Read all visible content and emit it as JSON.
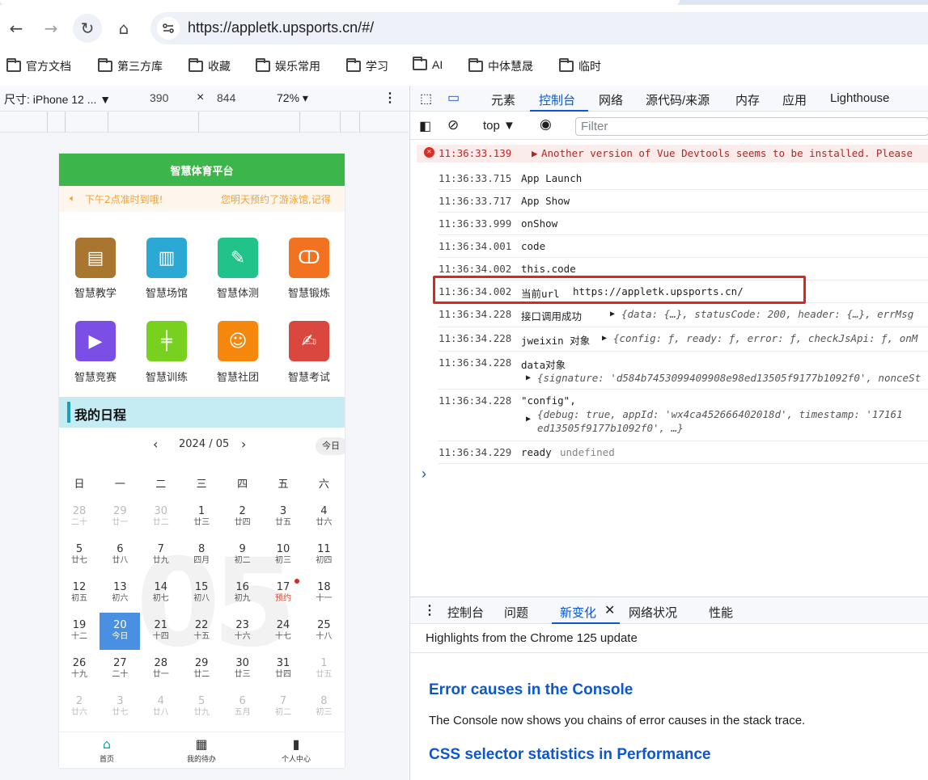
{
  "browser": {
    "url": "https://appletk.upsports.cn/#/",
    "bookmarks": [
      "官方文档",
      "第三方库",
      "收藏",
      "娱乐常用",
      "学习",
      "AI",
      "中体慧晟",
      "临时"
    ]
  },
  "device_toolbar": {
    "device": "尺寸: iPhone 12 ...",
    "width": "390",
    "times": "×",
    "height": "844",
    "zoom": "72%"
  },
  "app": {
    "header_title": "智慧体育平台",
    "notice_left": "下午2点准时到哦!",
    "notice_right": "您明天预约了游泳馆,记得",
    "grid": [
      {
        "label": "智慧教学",
        "color": "#a8762e",
        "icon": "printer-icon"
      },
      {
        "label": "智慧场馆",
        "color": "#2ba9d4",
        "icon": "building-icon"
      },
      {
        "label": "智慧体测",
        "color": "#22c38a",
        "icon": "clipboard-icon"
      },
      {
        "label": "智慧锻炼",
        "color": "#f3721f",
        "icon": "exercise-icon"
      },
      {
        "label": "智慧竞赛",
        "color": "#7b4fe6",
        "icon": "flag-icon"
      },
      {
        "label": "智慧训练",
        "color": "#78d11f",
        "icon": "dumbbell-icon"
      },
      {
        "label": "智慧社团",
        "color": "#f5870d",
        "icon": "group-icon"
      },
      {
        "label": "智慧考试",
        "color": "#d9473e",
        "icon": "exam-icon"
      }
    ],
    "schedule_title": "我的日程",
    "calendar": {
      "month_label": "2024 / 05",
      "today_button": "今日",
      "watermark": "05",
      "weekdays": [
        "日",
        "一",
        "二",
        "三",
        "四",
        "五",
        "六"
      ],
      "weeks": [
        [
          {
            "n": "28",
            "l": "二十",
            "o": true
          },
          {
            "n": "29",
            "l": "廿一",
            "o": true
          },
          {
            "n": "30",
            "l": "廿二",
            "o": true
          },
          {
            "n": "1",
            "l": "廿三"
          },
          {
            "n": "2",
            "l": "廿四"
          },
          {
            "n": "3",
            "l": "廿五"
          },
          {
            "n": "4",
            "l": "廿六"
          }
        ],
        [
          {
            "n": "5",
            "l": "廿七"
          },
          {
            "n": "6",
            "l": "廿八"
          },
          {
            "n": "7",
            "l": "廿九"
          },
          {
            "n": "8",
            "l": "四月"
          },
          {
            "n": "9",
            "l": "初二"
          },
          {
            "n": "10",
            "l": "初三"
          },
          {
            "n": "11",
            "l": "初四"
          }
        ],
        [
          {
            "n": "12",
            "l": "初五"
          },
          {
            "n": "13",
            "l": "初六"
          },
          {
            "n": "14",
            "l": "初七"
          },
          {
            "n": "15",
            "l": "初八"
          },
          {
            "n": "16",
            "l": "初九"
          },
          {
            "n": "17",
            "l": "预约",
            "mark": true
          },
          {
            "n": "18",
            "l": "十一"
          }
        ],
        [
          {
            "n": "19",
            "l": "十二"
          },
          {
            "n": "20",
            "l": "今日",
            "today": true
          },
          {
            "n": "21",
            "l": "十四"
          },
          {
            "n": "22",
            "l": "十五"
          },
          {
            "n": "23",
            "l": "十六"
          },
          {
            "n": "24",
            "l": "十七"
          },
          {
            "n": "25",
            "l": "十八"
          }
        ],
        [
          {
            "n": "26",
            "l": "十九"
          },
          {
            "n": "27",
            "l": "二十"
          },
          {
            "n": "28",
            "l": "廿一"
          },
          {
            "n": "29",
            "l": "廿二"
          },
          {
            "n": "30",
            "l": "廿三"
          },
          {
            "n": "31",
            "l": "廿四"
          },
          {
            "n": "1",
            "l": "廿五",
            "o": true
          }
        ],
        [
          {
            "n": "2",
            "l": "廿六",
            "o": true
          },
          {
            "n": "3",
            "l": "廿七",
            "o": true
          },
          {
            "n": "4",
            "l": "廿八",
            "o": true
          },
          {
            "n": "5",
            "l": "廿九",
            "o": true
          },
          {
            "n": "6",
            "l": "五月",
            "o": true
          },
          {
            "n": "7",
            "l": "初二",
            "o": true
          },
          {
            "n": "8",
            "l": "初三",
            "o": true
          }
        ]
      ]
    },
    "tabbar": [
      {
        "label": "首页",
        "icon": "home-icon"
      },
      {
        "label": "我的待办",
        "icon": "todo-icon"
      },
      {
        "label": "个人中心",
        "icon": "profile-icon"
      }
    ]
  },
  "devtools": {
    "tabs": [
      "元素",
      "控制台",
      "网络",
      "源代码/来源",
      "内存",
      "应用",
      "Lighthouse"
    ],
    "active_tab": "控制台",
    "context": "top",
    "filter_placeholder": "Filter",
    "error": {
      "ts": "11:36:33.139",
      "text": "Another version of Vue Devtools seems to be installed. Please"
    },
    "logs": [
      {
        "ts": "11:36:33.715",
        "text": "App Launch"
      },
      {
        "ts": "11:36:33.717",
        "text": "App Show"
      },
      {
        "ts": "11:36:33.999",
        "text": "onShow"
      },
      {
        "ts": "11:36:34.001",
        "text": "code"
      },
      {
        "ts": "11:36:34.002",
        "text": "this.code"
      },
      {
        "ts": "11:36:34.002",
        "text": "当前url",
        "link": "https://appletk.upsports.cn/"
      },
      {
        "ts": "11:36:34.228",
        "text": "接口调用成功",
        "obj": "{data: {…}, statusCode: 200, header: {…}, errMsg"
      },
      {
        "ts": "11:36:34.228",
        "text": "jweixin 对象",
        "obj": "{config: ƒ, ready: ƒ, error: ƒ, checkJsApi: ƒ, onM"
      },
      {
        "ts": "11:36:34.228",
        "text": "data对象",
        "obj": "{signature: 'd584b7453099409908e98ed13505f9177b1092f0', nonceSt"
      },
      {
        "ts": "11:36:34.228",
        "text": "\"config\",",
        "obj": "{debug: true, appId: 'wx4ca452666402018d', timestamp: '17161",
        "obj2": "ed13505f9177b1092f0',  …}"
      },
      {
        "ts": "11:36:34.229",
        "text": "ready",
        "extra": "undefined"
      }
    ],
    "prompt": "›",
    "drawer_tabs": [
      "控制台",
      "问题",
      "新变化",
      "网络状况",
      "性能"
    ],
    "drawer_active": "新变化",
    "whatsnew_title": "Highlights from the Chrome 125 update",
    "whatsnew_h1": "Error causes in the Console",
    "whatsnew_p1": "The Console now shows you chains of error causes in the stack trace.",
    "whatsnew_h2": "CSS selector statistics in Performance"
  }
}
